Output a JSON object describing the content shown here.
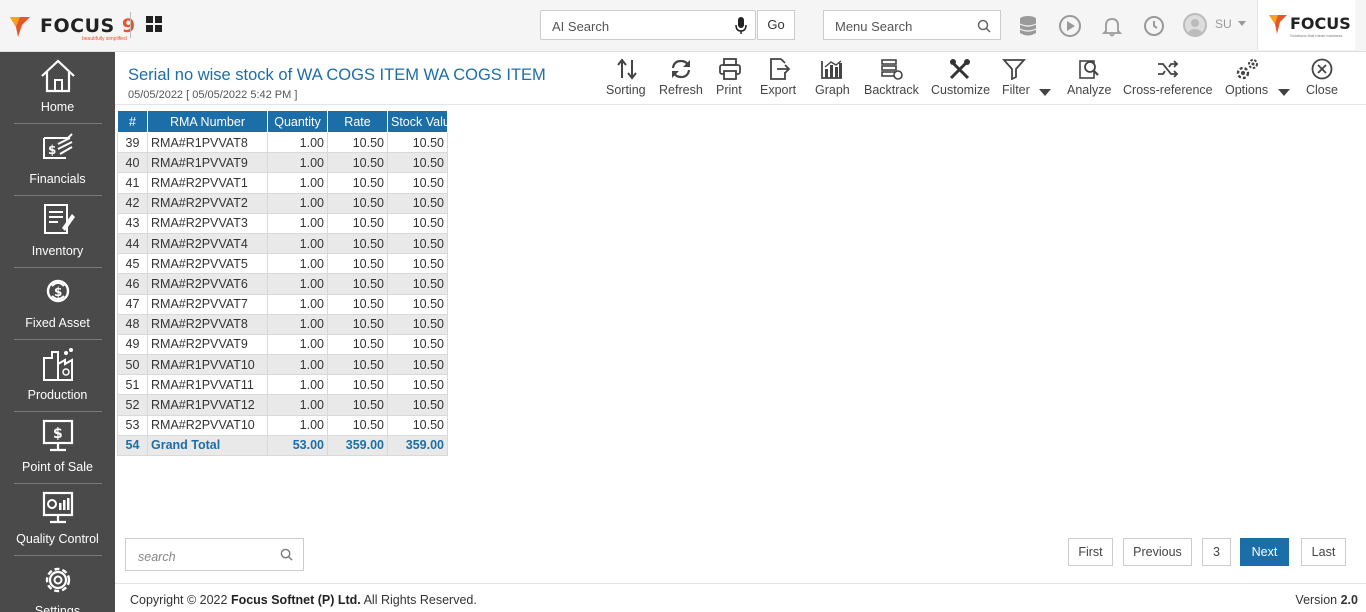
{
  "app": {
    "brand": "FOCUS",
    "brand_number": "9",
    "brand_tagline": "beautifully simplified",
    "right_logo_text": "FOCUS",
    "right_logo_tagline": "Solutions that mean business"
  },
  "header": {
    "ai_search_placeholder": "AI Search",
    "go_label": "Go",
    "menu_search_placeholder": "Menu Search",
    "user_initials": "SU"
  },
  "sidebar": {
    "items": [
      {
        "label": "Home",
        "icon": "home-icon"
      },
      {
        "label": "Financials",
        "icon": "financials-icon"
      },
      {
        "label": "Inventory",
        "icon": "inventory-icon"
      },
      {
        "label": "Fixed Asset",
        "icon": "fixed-asset-icon"
      },
      {
        "label": "Production",
        "icon": "production-icon"
      },
      {
        "label": "Point of Sale",
        "icon": "point-of-sale-icon"
      },
      {
        "label": "Quality Control",
        "icon": "quality-control-icon"
      },
      {
        "label": "Settings",
        "icon": "settings-icon"
      }
    ]
  },
  "report": {
    "title": "Serial no wise stock of WA COGS ITEM WA COGS ITEM",
    "date_line": "05/05/2022 [ 05/05/2022 5:42 PM ]"
  },
  "toolbar": {
    "sorting": "Sorting",
    "refresh": "Refresh",
    "print": "Print",
    "export": "Export",
    "graph": "Graph",
    "backtrack": "Backtrack",
    "customize": "Customize",
    "filter": "Filter",
    "analyze": "Analyze",
    "cross_reference": "Cross-reference",
    "options": "Options",
    "close": "Close"
  },
  "table": {
    "columns": [
      "#",
      "RMA Number",
      "Quantity",
      "Rate",
      "Stock Value"
    ],
    "rows": [
      [
        "39",
        "RMA#R1PVVAT8",
        "1.00",
        "10.50",
        "10.50"
      ],
      [
        "40",
        "RMA#R1PVVAT9",
        "1.00",
        "10.50",
        "10.50"
      ],
      [
        "41",
        "RMA#R2PVVAT1",
        "1.00",
        "10.50",
        "10.50"
      ],
      [
        "42",
        "RMA#R2PVVAT2",
        "1.00",
        "10.50",
        "10.50"
      ],
      [
        "43",
        "RMA#R2PVVAT3",
        "1.00",
        "10.50",
        "10.50"
      ],
      [
        "44",
        "RMA#R2PVVAT4",
        "1.00",
        "10.50",
        "10.50"
      ],
      [
        "45",
        "RMA#R2PVVAT5",
        "1.00",
        "10.50",
        "10.50"
      ],
      [
        "46",
        "RMA#R2PVVAT6",
        "1.00",
        "10.50",
        "10.50"
      ],
      [
        "47",
        "RMA#R2PVVAT7",
        "1.00",
        "10.50",
        "10.50"
      ],
      [
        "48",
        "RMA#R2PVVAT8",
        "1.00",
        "10.50",
        "10.50"
      ],
      [
        "49",
        "RMA#R2PVVAT9",
        "1.00",
        "10.50",
        "10.50"
      ],
      [
        "50",
        "RMA#R1PVVAT10",
        "1.00",
        "10.50",
        "10.50"
      ],
      [
        "51",
        "RMA#R1PVVAT11",
        "1.00",
        "10.50",
        "10.50"
      ],
      [
        "52",
        "RMA#R1PVVAT12",
        "1.00",
        "10.50",
        "10.50"
      ],
      [
        "53",
        "RMA#R2PVVAT10",
        "1.00",
        "10.50",
        "10.50"
      ]
    ],
    "total": [
      "54",
      "Grand Total",
      "53.00",
      "359.00",
      "359.00"
    ]
  },
  "bottom": {
    "search_placeholder": "search",
    "pagination": {
      "first": "First",
      "previous": "Previous",
      "current_page": "3",
      "next": "Next",
      "last": "Last"
    }
  },
  "footer": {
    "copyright_prefix": "Copyright © 2022 ",
    "company": "Focus Softnet (P) Ltd.",
    "rights": " All Rights Reserved.",
    "version_label": "Version",
    "version_number": "2.0"
  },
  "colors": {
    "accent": "#1b6ea8",
    "sidebar_bg": "#4a4a4a",
    "brand_orange": "#e8542b"
  }
}
